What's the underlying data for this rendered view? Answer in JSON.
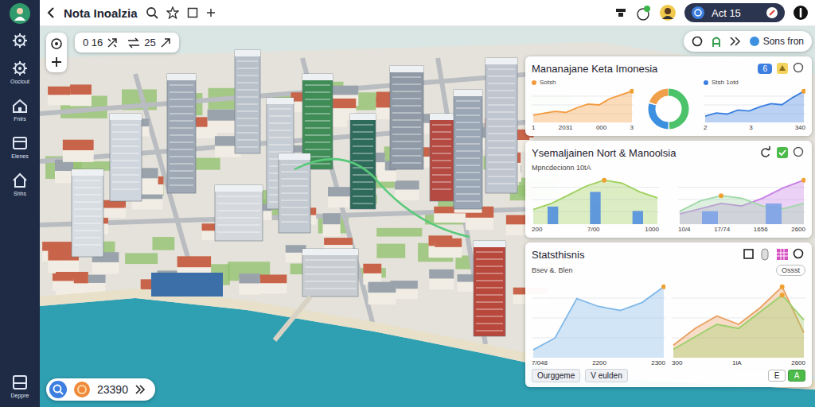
{
  "sidebar": {
    "items": [
      {
        "label": "Oociout",
        "selected": false
      },
      {
        "label": "Fnlrs",
        "selected": false
      },
      {
        "label": "Elenes",
        "selected": false
      },
      {
        "label": "Shhs",
        "selected": false
      }
    ],
    "footer": "Deppre"
  },
  "topbar": {
    "title": "Nota Inoalzia",
    "account": "Act 15"
  },
  "map": {
    "counters": [
      "0 16",
      "25"
    ],
    "mode": "Sons fron",
    "balance": "23390"
  },
  "panels": [
    {
      "title": "Mananajane Keta Imonesia",
      "badge": "6",
      "charts": [
        {
          "kind": "cartesian",
          "legend": "Sotsh",
          "ticks": [
            "1",
            "2031",
            "000",
            "3"
          ],
          "series": [
            {
              "kind": "area",
              "values": [
                8,
                10,
                12,
                11,
                16,
                20,
                19,
                26,
                30,
                34
              ],
              "color": "#f39a3d"
            }
          ]
        },
        {
          "kind": "donut",
          "series": [
            {
              "kind": "slice",
              "values": [
                50
              ],
              "color": "#4cc26a"
            },
            {
              "kind": "slice",
              "values": [
                30
              ],
              "color": "#3d8fe0"
            },
            {
              "kind": "slice",
              "values": [
                20
              ],
              "color": "#f0a04a"
            }
          ]
        },
        {
          "kind": "cartesian",
          "legend": "Stsh 1otd",
          "ticks": [
            "2",
            "3",
            "340"
          ],
          "series": [
            {
              "kind": "area",
              "values": [
                6,
                9,
                8,
                12,
                11,
                15,
                18,
                17,
                24,
                30
              ],
              "color": "#3a7fe0"
            }
          ]
        }
      ]
    },
    {
      "title": "Ysemaljainen Nort & Manoolsia",
      "subtitle": "Mpncdecionn 10tA",
      "charts": [
        {
          "kind": "cartesian",
          "ticks": [
            "200",
            "7/00",
            "1000"
          ],
          "series": [
            {
              "kind": "area",
              "values": [
                10,
                14,
                20,
                26,
                30,
                28,
                22,
                18
              ],
              "color": "#9ccf5a"
            },
            {
              "kind": "bar",
              "values": [
                12,
                22,
                9
              ],
              "color": "#4a8be0"
            }
          ]
        },
        {
          "kind": "cartesian",
          "ticks": [
            "10/4",
            "17/74",
            "1656",
            "2600"
          ],
          "series": [
            {
              "kind": "area",
              "values": [
                8,
                12,
                16,
                14,
                20,
                28,
                34
              ],
              "color": "#c77fe6"
            },
            {
              "kind": "area",
              "values": [
                10,
                18,
                22,
                20,
                14,
                12,
                16
              ],
              "color": "#9fd8a8"
            },
            {
              "kind": "bar",
              "values": [
                10,
                16
              ],
              "color": "#7aa0e8"
            }
          ]
        }
      ]
    },
    {
      "title": "Statsthisnis",
      "subtitle": "Bsev &. Blen",
      "chip": "Ossst",
      "charts": [
        {
          "kind": "cartesian",
          "ticks": [
            "7/048",
            "2200",
            "2300"
          ],
          "series": [
            {
              "kind": "area",
              "values": [
                4,
                10,
                30,
                26,
                24,
                28,
                36
              ],
              "color": "#7fb8e8"
            }
          ]
        },
        {
          "kind": "cartesian",
          "ticks": [
            "300",
            "1lA",
            "2600"
          ],
          "series": [
            {
              "kind": "area",
              "values": [
                6,
                14,
                20,
                16,
                24,
                34,
                12
              ],
              "color": "#e8a060"
            },
            {
              "kind": "area",
              "values": [
                4,
                10,
                16,
                14,
                22,
                30,
                18
              ],
              "color": "#9ccf6a"
            }
          ]
        }
      ],
      "buttons": [
        "Ourggeme",
        "V eulden"
      ],
      "segments": [
        {
          "label": "E",
          "selected": false
        },
        {
          "label": "A",
          "selected": true
        }
      ]
    }
  ]
}
